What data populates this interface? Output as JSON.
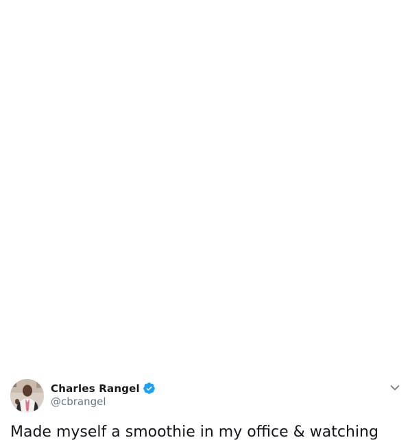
{
  "tweet": {
    "author": {
      "display_name": "Charles Rangel",
      "handle": "@cbrangel",
      "verified": true,
      "avatar_icon": "profile-photo"
    },
    "text": "Made myself a smoothie in my office & watching",
    "menu_icon": "chevron-down-icon"
  },
  "colors": {
    "verified_badge": "#1da1f2",
    "handle": "#657786",
    "text": "#14171a",
    "chevron": "#657786"
  }
}
